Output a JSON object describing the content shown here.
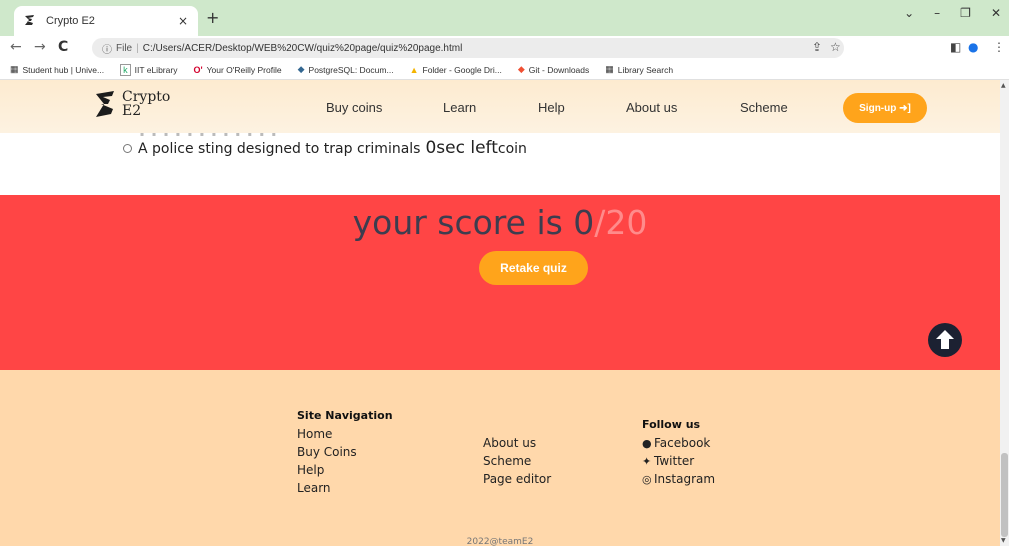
{
  "browser": {
    "tab_title": "Crypto E2",
    "tab_close": "×",
    "new_tab": "+",
    "url_info": "ⓘ",
    "url_scheme": "File",
    "url_sep": "|",
    "url": "C:/Users/ACER/Desktop/WEB%20CW/quiz%20page/quiz%20page.html",
    "bookmarks": [
      {
        "icon": "▦",
        "label": "Student hub | Unive..."
      },
      {
        "icon": "k",
        "label": "IIT eLibrary"
      },
      {
        "icon": "O'",
        "label": "Your O'Reilly Profile"
      },
      {
        "icon": "◆",
        "label": "PostgreSQL: Docum..."
      },
      {
        "icon": "▲",
        "label": "Folder - Google Dri..."
      },
      {
        "icon": "◆",
        "label": "Git - Downloads"
      },
      {
        "icon": "▦",
        "label": "Library Search"
      }
    ]
  },
  "header": {
    "logo_line1": "Crypto",
    "logo_line2": "E2",
    "nav": [
      "Buy coins",
      "Learn",
      "Help",
      "About us",
      "Scheme"
    ],
    "signup_label": "Sign-up ➜]"
  },
  "quiz": {
    "option_text": "A police sting designed to trap criminals",
    "timer_value": "0sec left",
    "timer_unit": "coin"
  },
  "score": {
    "prefix": "your score is 0",
    "total": "/20",
    "retake_label": "Retake quiz"
  },
  "footer": {
    "site_nav_heading": "Site Navigation",
    "site_nav_links": [
      "Home",
      "Buy Coins",
      "Help",
      "Learn"
    ],
    "more_links": [
      "About us",
      "Scheme",
      "Page editor"
    ],
    "follow_heading": "Follow us",
    "social": [
      "Facebook",
      "Twitter",
      "Instagram"
    ],
    "copyright": "2022@teamE2"
  },
  "colors": {
    "accent_orange": "#ffa41b",
    "score_background": "#ff4545",
    "footer_background": "#ffd8ab",
    "header_background": "#fdebd0"
  }
}
